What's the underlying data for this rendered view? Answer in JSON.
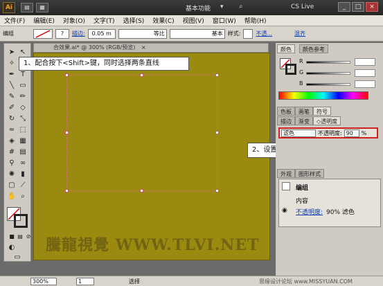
{
  "titlebar": {
    "logo": "Ai",
    "workspace_label": "基本功能",
    "cs_live": "CS Live",
    "win_min": "_",
    "win_max": "□",
    "win_close": "×"
  },
  "menu": [
    "文件(F)",
    "编辑(E)",
    "对象(O)",
    "文字(T)",
    "选择(S)",
    "效果(C)",
    "视图(V)",
    "窗口(W)",
    "帮助(H)"
  ],
  "control": {
    "group_label": "编组",
    "stroke_label": "描边:",
    "stroke_value": "0.05 m",
    "profile_label": "等比",
    "brush_label": "基本",
    "style_label": "样式:",
    "opacity_label": "不透...",
    "more_label": "混齐"
  },
  "document": {
    "tab_title": "合效果.ai* @ 300% (RGB/预览)",
    "tab_close": "×"
  },
  "callouts": {
    "step1": "1、配合按下<Shift>键，同时选择两条直线",
    "step2": "2、设置图形混合模式和不透明度"
  },
  "watermark": "騰龍視覺 WWW.TLVI.NET",
  "color_panel": {
    "tab_color": "颜色",
    "tab_guide": "颜色参考",
    "r": "R",
    "g": "G",
    "b": "B"
  },
  "swatch_tabs": [
    "色板",
    "画笔",
    "符号"
  ],
  "transparency": {
    "tab_stroke": "描边",
    "tab_gradient": "渐变",
    "tab_transparency": "透明度",
    "blend_mode": "滤色",
    "opacity_label": "不透明度:",
    "opacity_value": "90",
    "opacity_unit": "%"
  },
  "appearance": {
    "tab_appearance": "外观",
    "tab_styles": "图形样式",
    "group": "编组",
    "content": "内容",
    "opacity_link": "不透明度:",
    "opacity_detail": "90% 滤色"
  },
  "status": {
    "zoom": "300%",
    "page": "1",
    "tool": "选择",
    "watermark_text": "思缘设计论坛 www.MISSYUAN.COM"
  },
  "colors": {
    "canvas": "#9b8a10",
    "highlight": "#d02020",
    "selection": "#d07070"
  }
}
